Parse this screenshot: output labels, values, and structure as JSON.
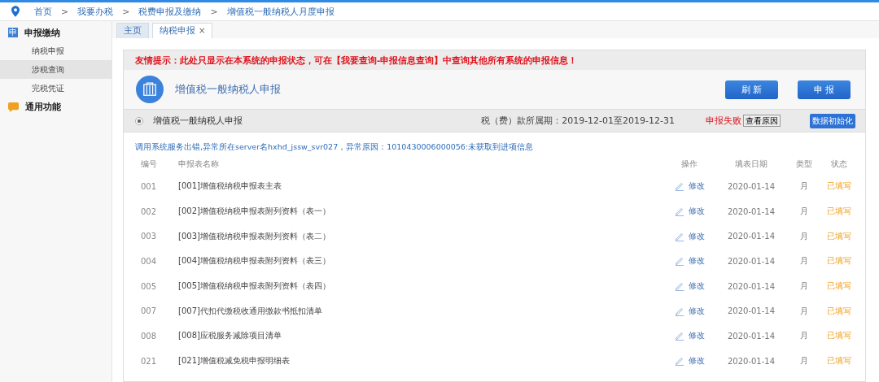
{
  "breadcrumb": [
    "首页",
    "我要办税",
    "税费申报及缴纳",
    "增值税一般纳税人月度申报"
  ],
  "breadcrumb_separator": ">",
  "sidebar": {
    "groups": [
      {
        "title": "申报缴纳",
        "icon_text": "申",
        "kind": "menu",
        "items": [
          {
            "label": "纳税申报",
            "selected": false
          },
          {
            "label": "涉税查询",
            "selected": true
          },
          {
            "label": "完税凭证",
            "selected": false
          }
        ]
      },
      {
        "title": "通用功能",
        "kind": "chat"
      }
    ]
  },
  "tabs": [
    {
      "label": "主页",
      "selected": false
    },
    {
      "label": "纳税申报",
      "selected": true,
      "close": "×"
    }
  ],
  "notice": "友情提示：此处只显示在本系统的申报状态，可在【我要查询-申报信息查询】中查询其他所有系统的申报信息！",
  "header": {
    "title": "增值税一般纳税人申报",
    "buttons": [
      "刷 新",
      "申 报"
    ]
  },
  "declaration": {
    "name": "增值税一般纳税人申报",
    "selected": true,
    "period": "税（费）款所属期：2019-12-01至2019-12-31",
    "status": "申报失败",
    "reason_button": "查看原因",
    "init_button": "数据初始化"
  },
  "error_message": "调用系统服务出错,异常所在server名hxhd_jssw_svr027，异常原因：1010430006000056:未获取到进项信息",
  "table": {
    "columns": [
      "编号",
      "申报表名称",
      "操作",
      "填表日期",
      "类型",
      "状态"
    ],
    "rows": [
      {
        "no": "001",
        "name": "[001]增值税纳税申报表主表",
        "action": "修改",
        "date": "2020-01-14",
        "type": "月",
        "status": "已填写"
      },
      {
        "no": "002",
        "name": "[002]增值税纳税申报表附列资料（表一）",
        "action": "修改",
        "date": "2020-01-14",
        "type": "月",
        "status": "已填写"
      },
      {
        "no": "003",
        "name": "[003]增值税纳税申报表附列资料（表二）",
        "action": "修改",
        "date": "2020-01-14",
        "type": "月",
        "status": "已填写"
      },
      {
        "no": "004",
        "name": "[004]增值税纳税申报表附列资料（表三）",
        "action": "修改",
        "date": "2020-01-14",
        "type": "月",
        "status": "已填写"
      },
      {
        "no": "005",
        "name": "[005]增值税纳税申报表附列资料（表四）",
        "action": "修改",
        "date": "2020-01-14",
        "type": "月",
        "status": "已填写"
      },
      {
        "no": "007",
        "name": "[007]代扣代缴税收通用缴款书抵扣清单",
        "action": "修改",
        "date": "2020-01-14",
        "type": "月",
        "status": "已填写"
      },
      {
        "no": "008",
        "name": "[008]应税服务减除项目清单",
        "action": "修改",
        "date": "2020-01-14",
        "type": "月",
        "status": "已填写"
      },
      {
        "no": "021",
        "name": "[021]增值税减免税申报明细表",
        "action": "修改",
        "date": "2020-01-14",
        "type": "月",
        "status": "已填写"
      }
    ]
  }
}
